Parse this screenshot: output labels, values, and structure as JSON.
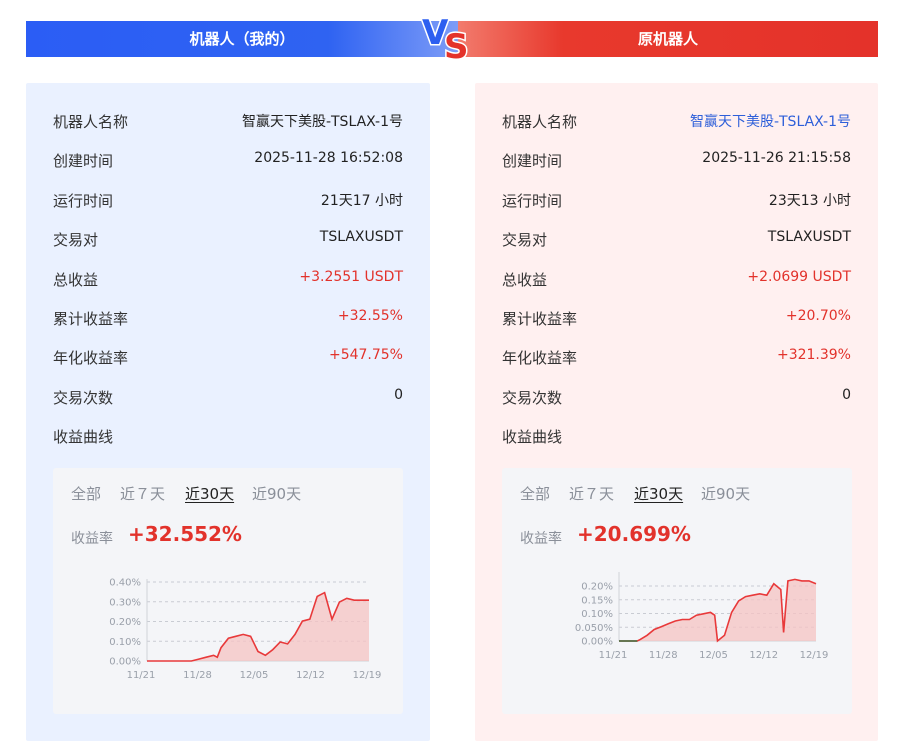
{
  "header": {
    "left_title": "机器人（我的）",
    "right_title": "原机器人",
    "vs_text": "VS"
  },
  "left": {
    "rows": [
      {
        "label": "机器人名称",
        "value": "智赢天下美股-TSLAX-1号",
        "style": ""
      },
      {
        "label": "创建时间",
        "value": "2025-11-28 16:52:08",
        "style": ""
      },
      {
        "label": "运行时间",
        "value": "21天17 小时",
        "style": ""
      },
      {
        "label": "交易对",
        "value": "TSLAXUSDT",
        "style": ""
      },
      {
        "label": "总收益",
        "value": "+3.2551 USDT",
        "style": "pos"
      },
      {
        "label": "累计收益率",
        "value": "+32.55%",
        "style": "pos"
      },
      {
        "label": "年化收益率",
        "value": "+547.75%",
        "style": "pos"
      },
      {
        "label": "交易次数",
        "value": "0",
        "style": ""
      }
    ],
    "curve_label": "收益曲线",
    "tabs": [
      "全部",
      "近７天",
      "近30天",
      "近90天"
    ],
    "active_tab": 2,
    "rate_label": "收益率",
    "rate_value": "+32.552%"
  },
  "right": {
    "rows": [
      {
        "label": "机器人名称",
        "value": "智赢天下美股-TSLAX-1号",
        "style": "link"
      },
      {
        "label": "创建时间",
        "value": "2025-11-26 21:15:58",
        "style": ""
      },
      {
        "label": "运行时间",
        "value": "23天13 小时",
        "style": ""
      },
      {
        "label": "交易对",
        "value": "TSLAXUSDT",
        "style": ""
      },
      {
        "label": "总收益",
        "value": "+2.0699 USDT",
        "style": "pos"
      },
      {
        "label": "累计收益率",
        "value": "+20.70%",
        "style": "pos"
      },
      {
        "label": "年化收益率",
        "value": "+321.39%",
        "style": "pos"
      },
      {
        "label": "交易次数",
        "value": "0",
        "style": ""
      }
    ],
    "curve_label": "收益曲线",
    "tabs": [
      "全部",
      "近７天",
      "近30天",
      "近90天"
    ],
    "active_tab": 2,
    "rate_label": "收益率",
    "rate_value": "+20.699%"
  },
  "colors": {
    "blue": "#2f63f2",
    "red": "#e4322a",
    "positive": "#e2322b",
    "curve": "#e8393a",
    "fill": "#f6c3c3",
    "flat": "#3a6b3a"
  },
  "chart_data": [
    {
      "type": "area",
      "x_ticks": [
        "11/21",
        "11/28",
        "12/05",
        "12/12",
        "12/19"
      ],
      "y_ticks": [
        "0.00%",
        "0.10%",
        "0.20%",
        "0.30%",
        "0.40%"
      ],
      "ylim": [
        0,
        0.4
      ],
      "grid": true,
      "series": [
        {
          "x": [
            0,
            3,
            6,
            7,
            8,
            9,
            9.5,
            10,
            11,
            12,
            13,
            14,
            15,
            16,
            17,
            18,
            19,
            20,
            21,
            22,
            23,
            24,
            25,
            26,
            27,
            28,
            29,
            30
          ],
          "values": [
            0,
            0,
            0,
            0.01,
            0.02,
            0.03,
            0.02,
            0.07,
            0.12,
            0.13,
            0.14,
            0.13,
            0.05,
            0.03,
            0.06,
            0.1,
            0.09,
            0.14,
            0.21,
            0.22,
            0.34,
            0.36,
            0.22,
            0.31,
            0.33,
            0.32,
            0.32,
            0.32
          ]
        }
      ]
    },
    {
      "type": "area",
      "x_ticks": [
        "11/21",
        "11/28",
        "12/05",
        "12/12",
        "12/19"
      ],
      "y_ticks": [
        "0.00%",
        "0.050%",
        "0.10%",
        "0.15%",
        "0.20%"
      ],
      "ylim": [
        0,
        0.22
      ],
      "grid": true,
      "series": [
        {
          "x": [
            0,
            2.6,
            3,
            4,
            5,
            6,
            7,
            8,
            9,
            10,
            11,
            12,
            13,
            13.6,
            14,
            15,
            16,
            17,
            18,
            19,
            20,
            21,
            22,
            23,
            23.4,
            24,
            25,
            26,
            27,
            28
          ],
          "values": [
            0,
            0,
            0.005,
            0.02,
            0.04,
            0.05,
            0.06,
            0.07,
            0.075,
            0.075,
            0.09,
            0.095,
            0.1,
            0.09,
            0.0,
            0.02,
            0.1,
            0.14,
            0.155,
            0.16,
            0.165,
            0.16,
            0.2,
            0.18,
            0.03,
            0.21,
            0.215,
            0.21,
            0.21,
            0.2
          ]
        }
      ]
    }
  ]
}
